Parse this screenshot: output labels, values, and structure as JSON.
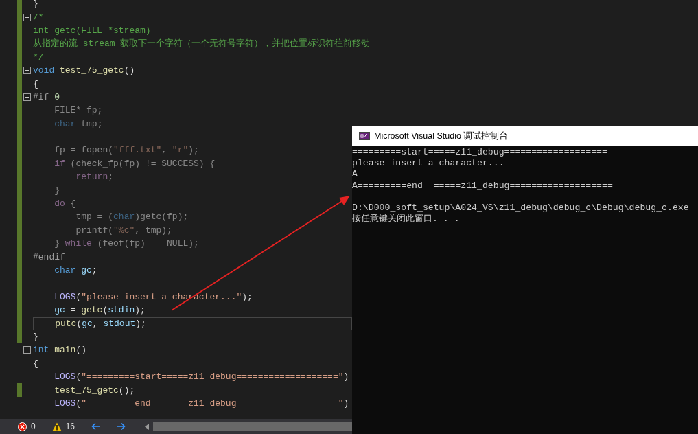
{
  "editor": {
    "lines": [
      {
        "changed": true,
        "tokens": [
          {
            "t": "}",
            "kind": "plain"
          }
        ]
      },
      {
        "changed": true,
        "fold": true,
        "tokens": [
          {
            "t": "/*",
            "kind": "comment"
          }
        ]
      },
      {
        "changed": true,
        "tokens": [
          {
            "t": "int getc(FILE *stream)",
            "kind": "comment"
          }
        ]
      },
      {
        "changed": true,
        "tokens": [
          {
            "t": "从指定的流 stream 获取下一个字符（一个无符号字符），并把位置标识符往前移动",
            "kind": "comment"
          }
        ]
      },
      {
        "changed": true,
        "tokens": [
          {
            "t": "*/",
            "kind": "comment"
          }
        ]
      },
      {
        "changed": true,
        "fold": true,
        "tokens": [
          {
            "t": "void",
            "kind": "keyword"
          },
          {
            "t": " test_75_getc",
            "kind": "func"
          },
          {
            "t": "()",
            "kind": "plain"
          }
        ]
      },
      {
        "changed": true,
        "tokens": [
          {
            "t": "{",
            "kind": "plain"
          }
        ]
      },
      {
        "changed": true,
        "fold": true,
        "tokens": [
          {
            "t": "#if",
            "kind": "preproc"
          },
          {
            "t": " 0",
            "kind": "number"
          }
        ]
      },
      {
        "changed": true,
        "inactive": true,
        "tokens": [
          {
            "t": "    FILE* fp;",
            "kind": "plain"
          }
        ]
      },
      {
        "changed": true,
        "inactive": true,
        "tokens": [
          {
            "t": "    char",
            "kind": "keyword"
          },
          {
            "t": " tmp;",
            "kind": "plain"
          }
        ]
      },
      {
        "changed": true
      },
      {
        "changed": true,
        "inactive": true,
        "tokens": [
          {
            "t": "    fp = fopen(",
            "kind": "plain"
          },
          {
            "t": "\"fff.txt\"",
            "kind": "string"
          },
          {
            "t": ", ",
            "kind": "plain"
          },
          {
            "t": "\"r\"",
            "kind": "string"
          },
          {
            "t": ");",
            "kind": "plain"
          }
        ]
      },
      {
        "changed": true,
        "inactive": true,
        "tokens": [
          {
            "t": "    if",
            "kind": "control"
          },
          {
            "t": " (check_fp(fp) != SUCCESS) {",
            "kind": "plain"
          }
        ]
      },
      {
        "changed": true,
        "inactive": true,
        "tokens": [
          {
            "t": "        return",
            "kind": "control"
          },
          {
            "t": ";",
            "kind": "plain"
          }
        ]
      },
      {
        "changed": true,
        "inactive": true,
        "tokens": [
          {
            "t": "    }",
            "kind": "plain"
          }
        ]
      },
      {
        "changed": true,
        "inactive": true,
        "tokens": [
          {
            "t": "    do",
            "kind": "control"
          },
          {
            "t": " {",
            "kind": "plain"
          }
        ]
      },
      {
        "changed": true,
        "inactive": true,
        "tokens": [
          {
            "t": "        tmp = (",
            "kind": "plain"
          },
          {
            "t": "char",
            "kind": "keyword"
          },
          {
            "t": ")getc(fp);",
            "kind": "plain"
          }
        ]
      },
      {
        "changed": true,
        "inactive": true,
        "tokens": [
          {
            "t": "        printf(",
            "kind": "plain"
          },
          {
            "t": "\"%c\"",
            "kind": "string"
          },
          {
            "t": ", tmp);",
            "kind": "plain"
          }
        ]
      },
      {
        "changed": true,
        "inactive": true,
        "tokens": [
          {
            "t": "    } ",
            "kind": "plain"
          },
          {
            "t": "while",
            "kind": "control"
          },
          {
            "t": " (feof(fp) == NULL);",
            "kind": "plain"
          }
        ]
      },
      {
        "changed": true,
        "tokens": [
          {
            "t": "#endif",
            "kind": "preproc"
          }
        ]
      },
      {
        "changed": true,
        "tokens": [
          {
            "t": "    char",
            "kind": "keyword"
          },
          {
            "t": " gc",
            "kind": "var"
          },
          {
            "t": ";",
            "kind": "plain"
          }
        ]
      },
      {
        "changed": true
      },
      {
        "changed": true,
        "tokens": [
          {
            "t": "    LOGS",
            "kind": "macro"
          },
          {
            "t": "(",
            "kind": "plain"
          },
          {
            "t": "\"please insert a character...\"",
            "kind": "string"
          },
          {
            "t": ");",
            "kind": "plain"
          }
        ]
      },
      {
        "changed": true,
        "tokens": [
          {
            "t": "    gc",
            "kind": "var"
          },
          {
            "t": " = ",
            "kind": "plain"
          },
          {
            "t": "getc",
            "kind": "func"
          },
          {
            "t": "(",
            "kind": "plain"
          },
          {
            "t": "stdin",
            "kind": "var"
          },
          {
            "t": ");",
            "kind": "plain"
          }
        ]
      },
      {
        "changed": true,
        "current": true,
        "tokens": [
          {
            "t": "    putc",
            "kind": "func"
          },
          {
            "t": "(",
            "kind": "plain"
          },
          {
            "t": "gc",
            "kind": "var"
          },
          {
            "t": ", ",
            "kind": "plain"
          },
          {
            "t": "stdout",
            "kind": "var"
          },
          {
            "t": ");",
            "kind": "plain"
          }
        ]
      },
      {
        "changed": true,
        "tokens": [
          {
            "t": "}",
            "kind": "plain"
          }
        ]
      },
      {
        "changed": false,
        "fold": true,
        "tokens": [
          {
            "t": "int",
            "kind": "keyword"
          },
          {
            "t": " main",
            "kind": "func"
          },
          {
            "t": "()",
            "kind": "plain"
          }
        ]
      },
      {
        "changed": false,
        "tokens": [
          {
            "t": "{",
            "kind": "plain"
          }
        ]
      },
      {
        "changed": false,
        "tokens": [
          {
            "t": "    LOGS",
            "kind": "macro"
          },
          {
            "t": "(",
            "kind": "plain"
          },
          {
            "t": "\"=========start=====z11_debug===================\"",
            "kind": "string"
          },
          {
            "t": ")",
            "kind": "plain"
          }
        ]
      },
      {
        "changed": true,
        "tokens": [
          {
            "t": "    test_75_getc",
            "kind": "func"
          },
          {
            "t": "();",
            "kind": "plain"
          }
        ]
      },
      {
        "changed": false,
        "tokens": [
          {
            "t": "    LOGS",
            "kind": "macro"
          },
          {
            "t": "(",
            "kind": "plain"
          },
          {
            "t": "\"=========end  =====z11_debug===================\"",
            "kind": "string"
          },
          {
            "t": ")",
            "kind": "plain"
          }
        ]
      },
      {
        "changed": false
      }
    ]
  },
  "status_bar": {
    "errors": "0",
    "warnings": "16"
  },
  "console": {
    "title": "Microsoft Visual Studio 调试控制台",
    "lines": [
      "=========start=====z11_debug===================",
      "please insert a character...",
      "A",
      "A=========end  =====z11_debug===================",
      {
        "text": "D:\\D000_soft_setup\\A024_VS\\z11_debug\\debug_c\\Debug\\debug_c.exe",
        "space_before": true
      },
      "按任意键关闭此窗口. . ."
    ]
  }
}
